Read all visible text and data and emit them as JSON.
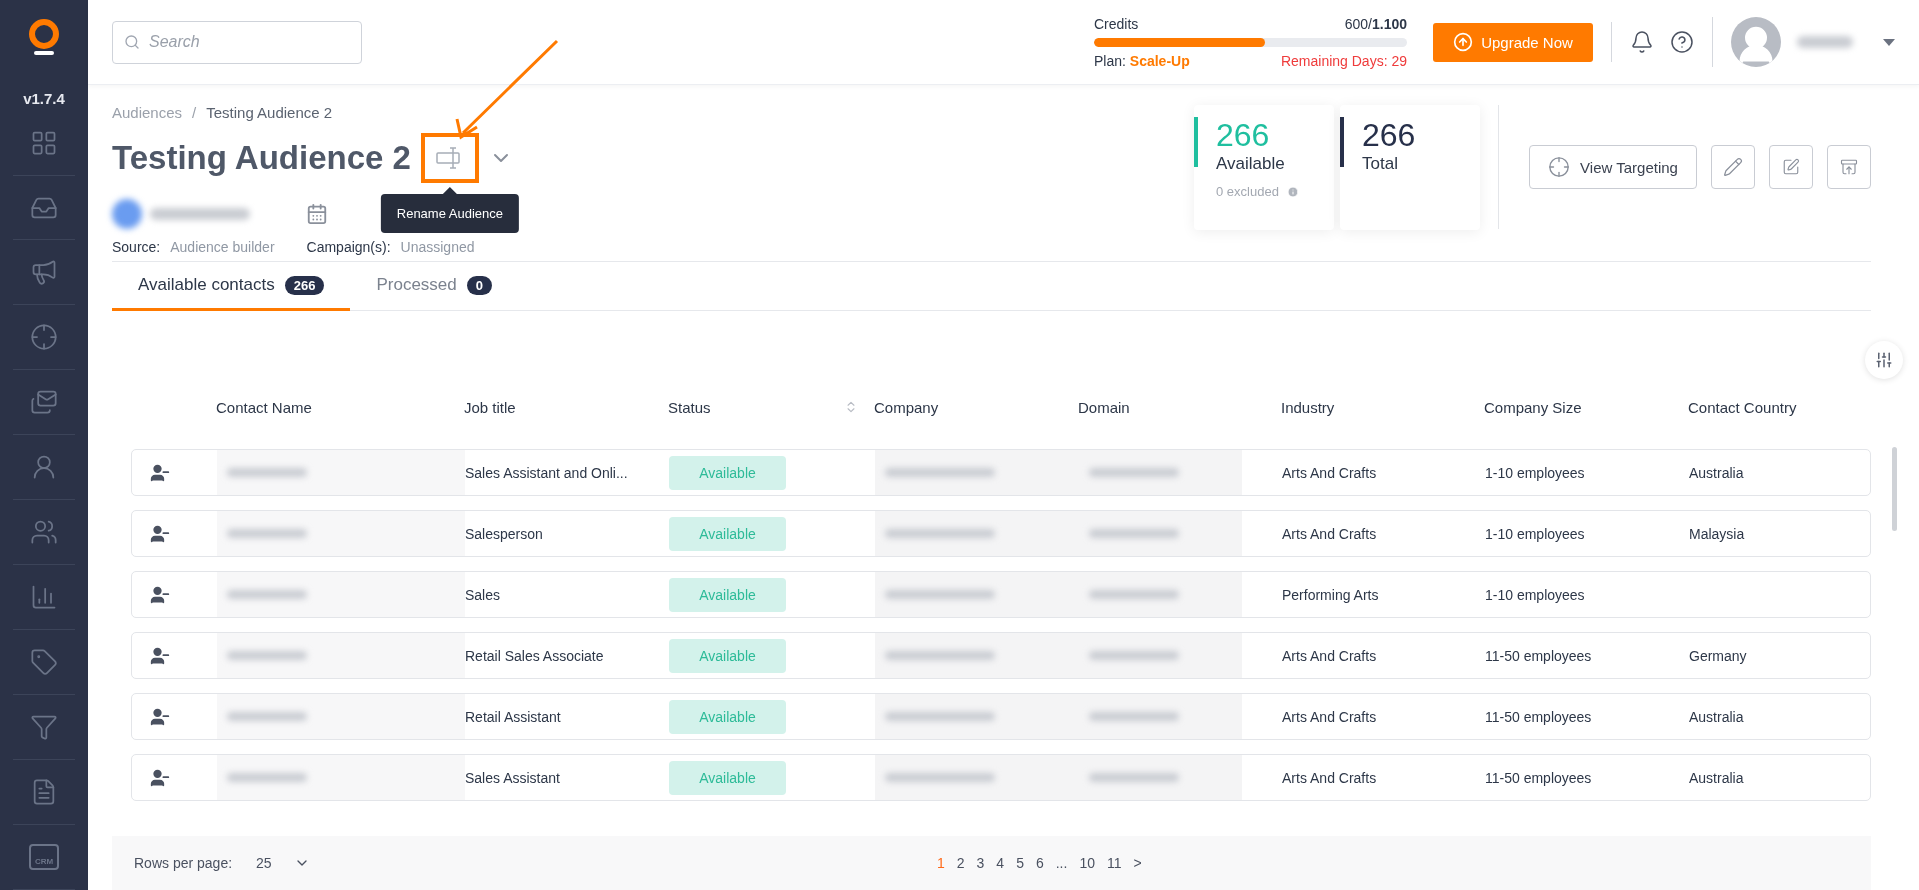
{
  "sidebar": {
    "version": "v1.7.4",
    "crm_label": "CRM"
  },
  "topbar": {
    "search": {
      "placeholder": "Search"
    },
    "credits": {
      "label": "Credits",
      "amount": "600/**1.100**",
      "level": 0.545,
      "plan_label": "Plan:",
      "plan": "Scale-Up",
      "remaining": "Remaining Days: 29"
    },
    "upgrade_button": "Upgrade Now"
  },
  "breadcrumb": {
    "items": [
      "Audiences",
      "Testing Audience 2"
    ],
    "separator": "/"
  },
  "title": "Testing Audience 2",
  "tooltip": "Rename Audience",
  "meta": [
    {
      "label": "Source:",
      "value": "Audience builder"
    },
    {
      "label": "Campaign(s):",
      "value": "Unassigned"
    }
  ],
  "stats": [
    {
      "value": "266",
      "label": "Available",
      "note": "0 excluded",
      "color": "#1fbf9f"
    },
    {
      "value": "266",
      "label": "Total",
      "color": "#27304a"
    }
  ],
  "actions": {
    "view_targeting": "View Targeting"
  },
  "tabs": [
    {
      "label": "Available contacts",
      "count": "266",
      "selected": true
    },
    {
      "label": "Processed",
      "count": "0",
      "selected": false
    }
  ],
  "table": {
    "columns": [
      "Contact Name",
      "Job title",
      "Status",
      "Company",
      "Domain",
      "Industry",
      "Company Size",
      "Contact Country"
    ],
    "rows": [
      {
        "job_title": "Sales Assistant and Onli...",
        "status": "Available",
        "industry": "Arts And Crafts",
        "company_size": "1-10 employees",
        "country": "Australia"
      },
      {
        "job_title": "Salesperson",
        "status": "Available",
        "industry": "Arts And Crafts",
        "company_size": "1-10 employees",
        "country": "Malaysia"
      },
      {
        "job_title": "Sales",
        "status": "Available",
        "industry": "Performing Arts",
        "company_size": "1-10 employees"
      },
      {
        "job_title": "Retail Sales Associate",
        "status": "Available",
        "industry": "Arts And Crafts",
        "company_size": "11-50 employees",
        "country": "Germany"
      },
      {
        "job_title": "Retail Assistant",
        "status": "Available",
        "industry": "Arts And Crafts",
        "company_size": "11-50 employees",
        "country": "Australia"
      },
      {
        "job_title": "Sales Assistant",
        "status": "Available",
        "industry": "Arts And Crafts",
        "company_size": "11-50 employees",
        "country": "Australia"
      }
    ]
  },
  "pagination": {
    "rows_label": "Rows per page:",
    "rows_value": "25",
    "pages": [
      {
        "label": "1",
        "selected": true
      },
      {
        "label": "2",
        "selected": false
      },
      {
        "label": "3",
        "selected": false
      },
      {
        "label": "4",
        "selected": false
      },
      {
        "label": "5",
        "selected": false
      },
      {
        "label": "6",
        "selected": false
      },
      {
        "label": "...",
        "selected": false
      },
      {
        "label": "10",
        "selected": false
      },
      {
        "label": "11",
        "selected": false
      }
    ],
    "next": ">"
  }
}
